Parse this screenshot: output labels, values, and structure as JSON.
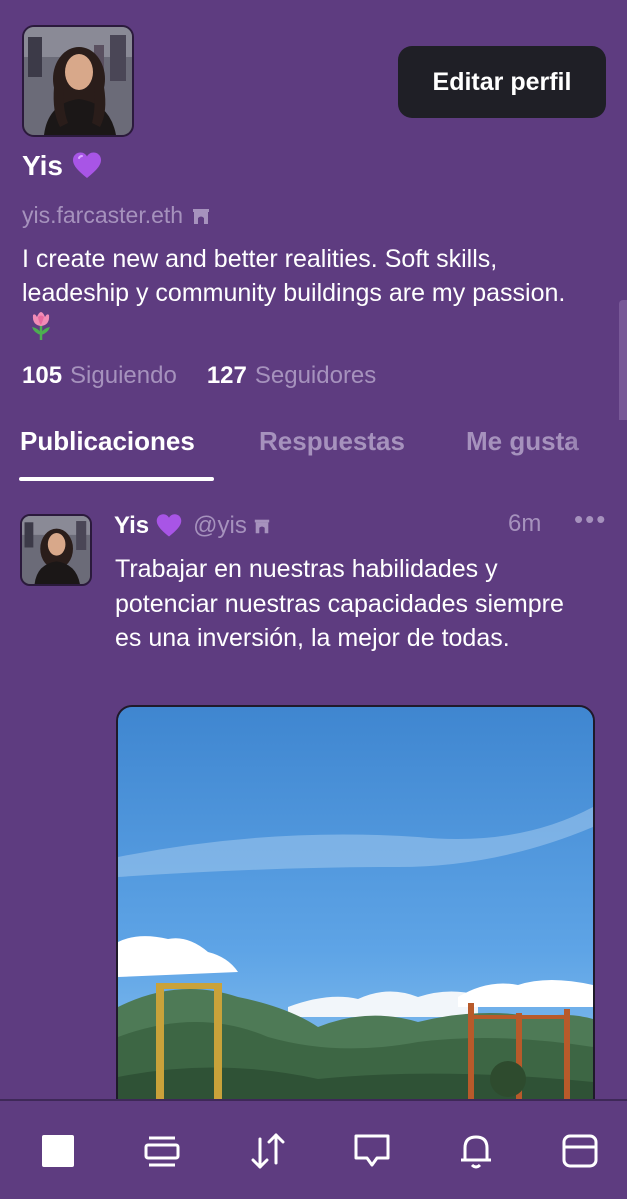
{
  "profile": {
    "display_name": "Yis",
    "username": "yis.farcaster.eth",
    "bio": "I create new and better realities. Soft skills, leadeship y community buildings are my passion.",
    "edit_label": "Editar perfil",
    "following_count": "105",
    "following_label": "Siguiendo",
    "followers_count": "127",
    "followers_label": "Seguidores"
  },
  "tabs": [
    {
      "label": "Publicaciones",
      "active": true
    },
    {
      "label": "Respuestas",
      "active": false
    },
    {
      "label": "Me gusta",
      "active": false
    }
  ],
  "post": {
    "author": "Yis",
    "handle": "@yis",
    "time": "6m",
    "more": "•••",
    "text": "Trabajar en nuestras habilidades y potenciar nuestras capacidades siempre es una inversión, la mejor de todas."
  },
  "icons": {
    "heart": "purple-heart-icon",
    "verified": "arch-icon",
    "tulip": "tulip-icon"
  },
  "bottom_nav": [
    {
      "icon": "home-icon"
    },
    {
      "icon": "feed-icon"
    },
    {
      "icon": "trade-icon"
    },
    {
      "icon": "messages-icon"
    },
    {
      "icon": "notifications-icon"
    },
    {
      "icon": "profile-icon"
    }
  ],
  "colors": {
    "background": "#5e3c80",
    "muted": "#a692bd",
    "button": "#1f1f26",
    "heart": "#a855e6"
  }
}
